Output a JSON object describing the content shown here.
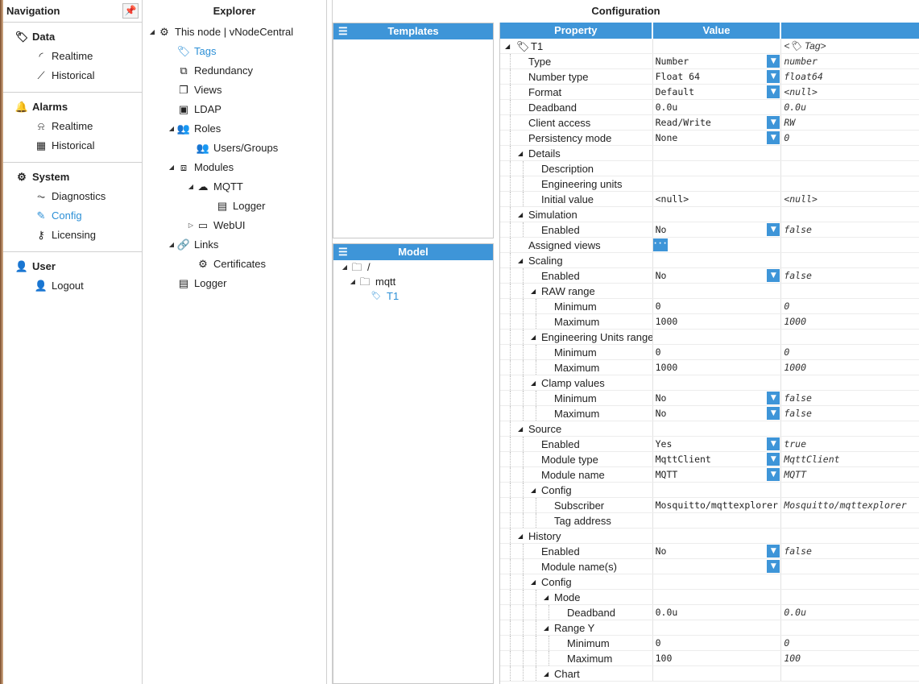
{
  "navigation": {
    "title": "Navigation",
    "sections": [
      {
        "head": "Data",
        "icon": "tag-icon",
        "items": [
          {
            "label": "Realtime",
            "icon": "rss-icon"
          },
          {
            "label": "Historical",
            "icon": "chart-line-icon"
          }
        ]
      },
      {
        "head": "Alarms",
        "icon": "bell-icon",
        "items": [
          {
            "label": "Realtime",
            "icon": "alarm-icon"
          },
          {
            "label": "Historical",
            "icon": "table-icon"
          }
        ]
      },
      {
        "head": "System",
        "icon": "gear-icon",
        "items": [
          {
            "label": "Diagnostics",
            "icon": "pulse-icon"
          },
          {
            "label": "Config",
            "icon": "edit-icon"
          },
          {
            "label": "Licensing",
            "icon": "key-icon"
          }
        ]
      },
      {
        "head": "User",
        "icon": "user-icon",
        "items": [
          {
            "label": "Logout",
            "icon": "user-x-icon"
          }
        ]
      }
    ]
  },
  "explorer": {
    "title": "Explorer",
    "nodes": [
      "This node | vNodeCentral",
      "Tags",
      "Redundancy",
      "Views",
      "LDAP",
      "Roles",
      "Users/Groups",
      "Modules",
      "MQTT",
      "Logger",
      "WebUI",
      "Links",
      "Certificates",
      "Logger"
    ]
  },
  "configuration": {
    "title": "Configuration",
    "templates_title": "Templates",
    "model_title": "Model",
    "model_nodes": [
      "/",
      "mqtt",
      "T1"
    ],
    "grid_headers": [
      "Property",
      "Value"
    ],
    "root": "T1",
    "root_raw": "Tag",
    "rows": [
      [
        "Type",
        "Number",
        "number"
      ],
      [
        "Number type",
        "Float 64",
        "float64"
      ],
      [
        "Format",
        "Default",
        "<null>"
      ],
      [
        "Deadband",
        "0.0u",
        "0.0u"
      ],
      [
        "Client access",
        "Read/Write",
        "RW"
      ],
      [
        "Persistency mode",
        "None",
        "0"
      ],
      [
        "Details",
        "",
        ""
      ],
      [
        "Description",
        "",
        ""
      ],
      [
        "Engineering units",
        "",
        ""
      ],
      [
        "Initial value",
        "<null>",
        "<null>"
      ],
      [
        "Simulation",
        "",
        ""
      ],
      [
        "Enabled",
        "No",
        "false"
      ],
      [
        "Assigned views",
        "",
        ""
      ],
      [
        "Scaling",
        "",
        ""
      ],
      [
        "Enabled",
        "No",
        "false"
      ],
      [
        "RAW range",
        "",
        ""
      ],
      [
        "Minimum",
        "0",
        "0"
      ],
      [
        "Maximum",
        "1000",
        "1000"
      ],
      [
        "Engineering Units range",
        "",
        ""
      ],
      [
        "Minimum",
        "0",
        "0"
      ],
      [
        "Maximum",
        "1000",
        "1000"
      ],
      [
        "Clamp values",
        "",
        ""
      ],
      [
        "Minimum",
        "No",
        "false"
      ],
      [
        "Maximum",
        "No",
        "false"
      ],
      [
        "Source",
        "",
        ""
      ],
      [
        "Enabled",
        "Yes",
        "true"
      ],
      [
        "Module type",
        "MqttClient",
        "MqttClient"
      ],
      [
        "Module name",
        "MQTT",
        "MQTT"
      ],
      [
        "Config",
        "",
        ""
      ],
      [
        "Subscriber",
        "Mosquitto/mqttexplorer",
        "Mosquitto/mqttexplorer"
      ],
      [
        "Tag address",
        "",
        ""
      ],
      [
        "History",
        "",
        ""
      ],
      [
        "Enabled",
        "No",
        "false"
      ],
      [
        "Module name(s)",
        "",
        ""
      ],
      [
        "Config",
        "",
        ""
      ],
      [
        "Mode",
        "",
        ""
      ],
      [
        "Deadband",
        "0.0u",
        "0.0u"
      ],
      [
        "Range Y",
        "",
        ""
      ],
      [
        "Minimum",
        "0",
        "0"
      ],
      [
        "Maximum",
        "100",
        "100"
      ],
      [
        "Chart",
        "",
        ""
      ]
    ]
  }
}
